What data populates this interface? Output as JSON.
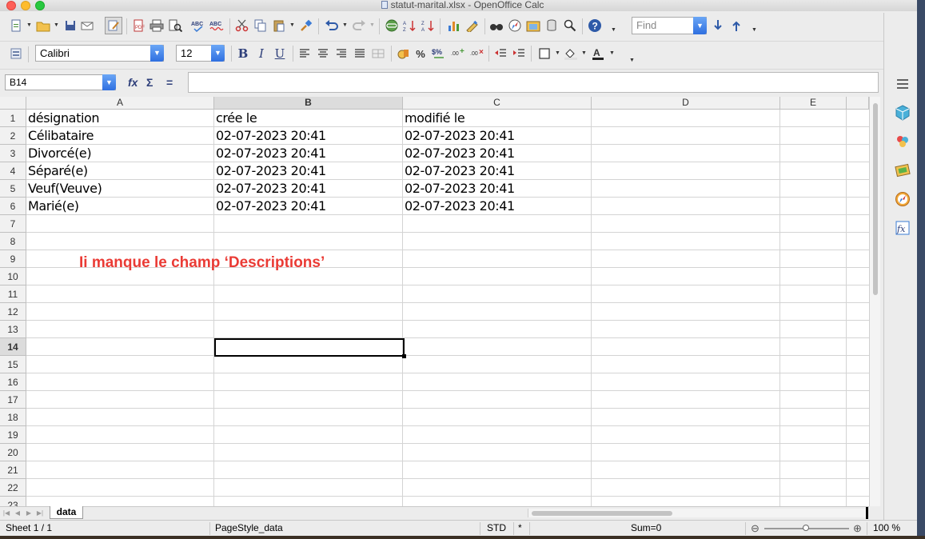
{
  "window": {
    "title": "statut-marital.xlsx - OpenOffice Calc"
  },
  "toolbar": {
    "find_placeholder": "Find",
    "font_name": "Calibri",
    "font_size": "12",
    "bold_label": "B",
    "italic_label": "I",
    "underline_label": "U",
    "percent_label": "%"
  },
  "formula_bar": {
    "name_box": "B14",
    "fx_label": "fx",
    "sum_label": "Σ",
    "equals_label": "=",
    "content": ""
  },
  "grid": {
    "columns": [
      "A",
      "B",
      "C",
      "D",
      "E"
    ],
    "active_column": "B",
    "rows": [
      "1",
      "2",
      "3",
      "4",
      "5",
      "6",
      "7",
      "8",
      "9",
      "10",
      "11",
      "12",
      "13",
      "14",
      "15",
      "16",
      "17",
      "18",
      "19",
      "20",
      "21",
      "22",
      "23"
    ],
    "active_row": "14",
    "cells": [
      [
        "désignation",
        "crée le",
        "modifié le"
      ],
      [
        "Célibataire",
        "02-07-2023 20:41",
        "02-07-2023 20:41"
      ],
      [
        "Divorcé(e)",
        "02-07-2023 20:41",
        "02-07-2023 20:41"
      ],
      [
        "Séparé(e)",
        "02-07-2023 20:41",
        "02-07-2023 20:41"
      ],
      [
        "Veuf(Veuve)",
        "02-07-2023 20:41",
        "02-07-2023 20:41"
      ],
      [
        "Marié(e)",
        "02-07-2023 20:41",
        "02-07-2023 20:41"
      ]
    ],
    "annotation": "Ii manque le champ ‘Descriptions’",
    "annotation_color": "#ea3b35"
  },
  "sheet_tabs": {
    "active": "data"
  },
  "status_bar": {
    "sheet": "Sheet 1 / 1",
    "page_style": "PageStyle_data",
    "mode": "STD",
    "modified": "*",
    "sum": "Sum=0",
    "zoom": "100 %",
    "zoom_minus": "⊖",
    "zoom_plus": "⊕"
  },
  "icons": {
    "toolbar1": [
      "new-document-icon",
      "open-icon",
      "save-icon",
      "email-icon",
      "edit-mode-icon",
      "export-pdf-icon",
      "print-icon",
      "page-preview-icon",
      "spellcheck-icon",
      "autospell-icon",
      "cut-icon",
      "copy-icon",
      "paste-icon",
      "format-paintbrush-icon",
      "undo-icon",
      "redo-icon",
      "hyperlink-icon",
      "sort-ascending-icon",
      "sort-descending-icon",
      "chart-icon",
      "draw-functions-icon",
      "find-replace-icon",
      "navigator-icon",
      "gallery-icon",
      "data-sources-icon",
      "zoom-icon",
      "help-icon"
    ],
    "toolbar2": [
      "styles-icon",
      "align-left-icon",
      "align-center-icon",
      "align-right-icon",
      "justify-icon",
      "merge-cells-icon",
      "currency-icon",
      "percent-icon",
      "standard-format-icon",
      "add-decimal-icon",
      "delete-decimal-icon",
      "decrease-indent-icon",
      "increase-indent-icon",
      "borders-icon",
      "background-color-icon",
      "font-color-icon"
    ],
    "sidebar": [
      "sidebar-menu-icon",
      "properties-icon",
      "styles-sidebar-icon",
      "gallery-sidebar-icon",
      "navigator-sidebar-icon",
      "functions-sidebar-icon"
    ]
  }
}
